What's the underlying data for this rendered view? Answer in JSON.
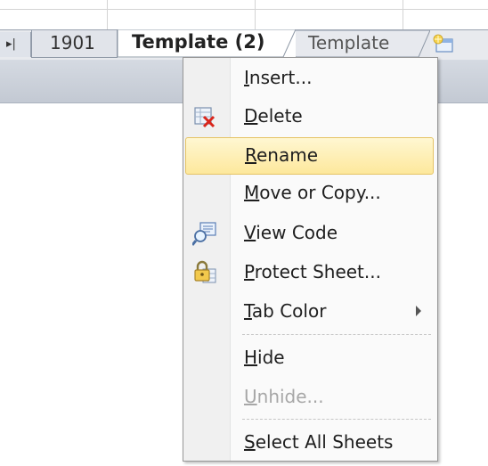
{
  "tabs": {
    "nav_glyph": "▸|",
    "items": [
      {
        "label": "1901",
        "state": "inactive"
      },
      {
        "label": "Template (2)",
        "state": "active"
      },
      {
        "label": "Template",
        "state": "inactive"
      }
    ],
    "new_sheet_icon": "insert-worksheet-icon"
  },
  "context_menu": {
    "items": [
      {
        "label_pre": "",
        "label_u": "I",
        "label_post": "nsert...",
        "icon": "",
        "state": "normal"
      },
      {
        "label_pre": "",
        "label_u": "D",
        "label_post": "elete",
        "icon": "delete-sheet-icon",
        "state": "normal"
      },
      {
        "label_pre": "",
        "label_u": "R",
        "label_post": "ename",
        "icon": "",
        "state": "hover"
      },
      {
        "label_pre": "",
        "label_u": "M",
        "label_post": "ove or Copy...",
        "icon": "",
        "state": "normal"
      },
      {
        "label_pre": "",
        "label_u": "V",
        "label_post": "iew Code",
        "icon": "view-code-icon",
        "state": "normal"
      },
      {
        "label_pre": "",
        "label_u": "P",
        "label_post": "rotect Sheet...",
        "icon": "protect-sheet-icon",
        "state": "normal"
      },
      {
        "label_pre": "",
        "label_u": "T",
        "label_post": "ab Color",
        "icon": "",
        "state": "normal",
        "submenu": true
      },
      {
        "label_pre": "",
        "label_u": "H",
        "label_post": "ide",
        "icon": "",
        "state": "normal"
      },
      {
        "label_pre": "",
        "label_u": "U",
        "label_post": "nhide...",
        "icon": "",
        "state": "disabled"
      },
      {
        "label_pre": "",
        "label_u": "S",
        "label_post": "elect All Sheets",
        "icon": "",
        "state": "normal"
      }
    ]
  },
  "colors": {
    "hover_fill": "#fde89c",
    "hover_border": "#e5c365",
    "disabled_text": "#a7a7a7"
  }
}
